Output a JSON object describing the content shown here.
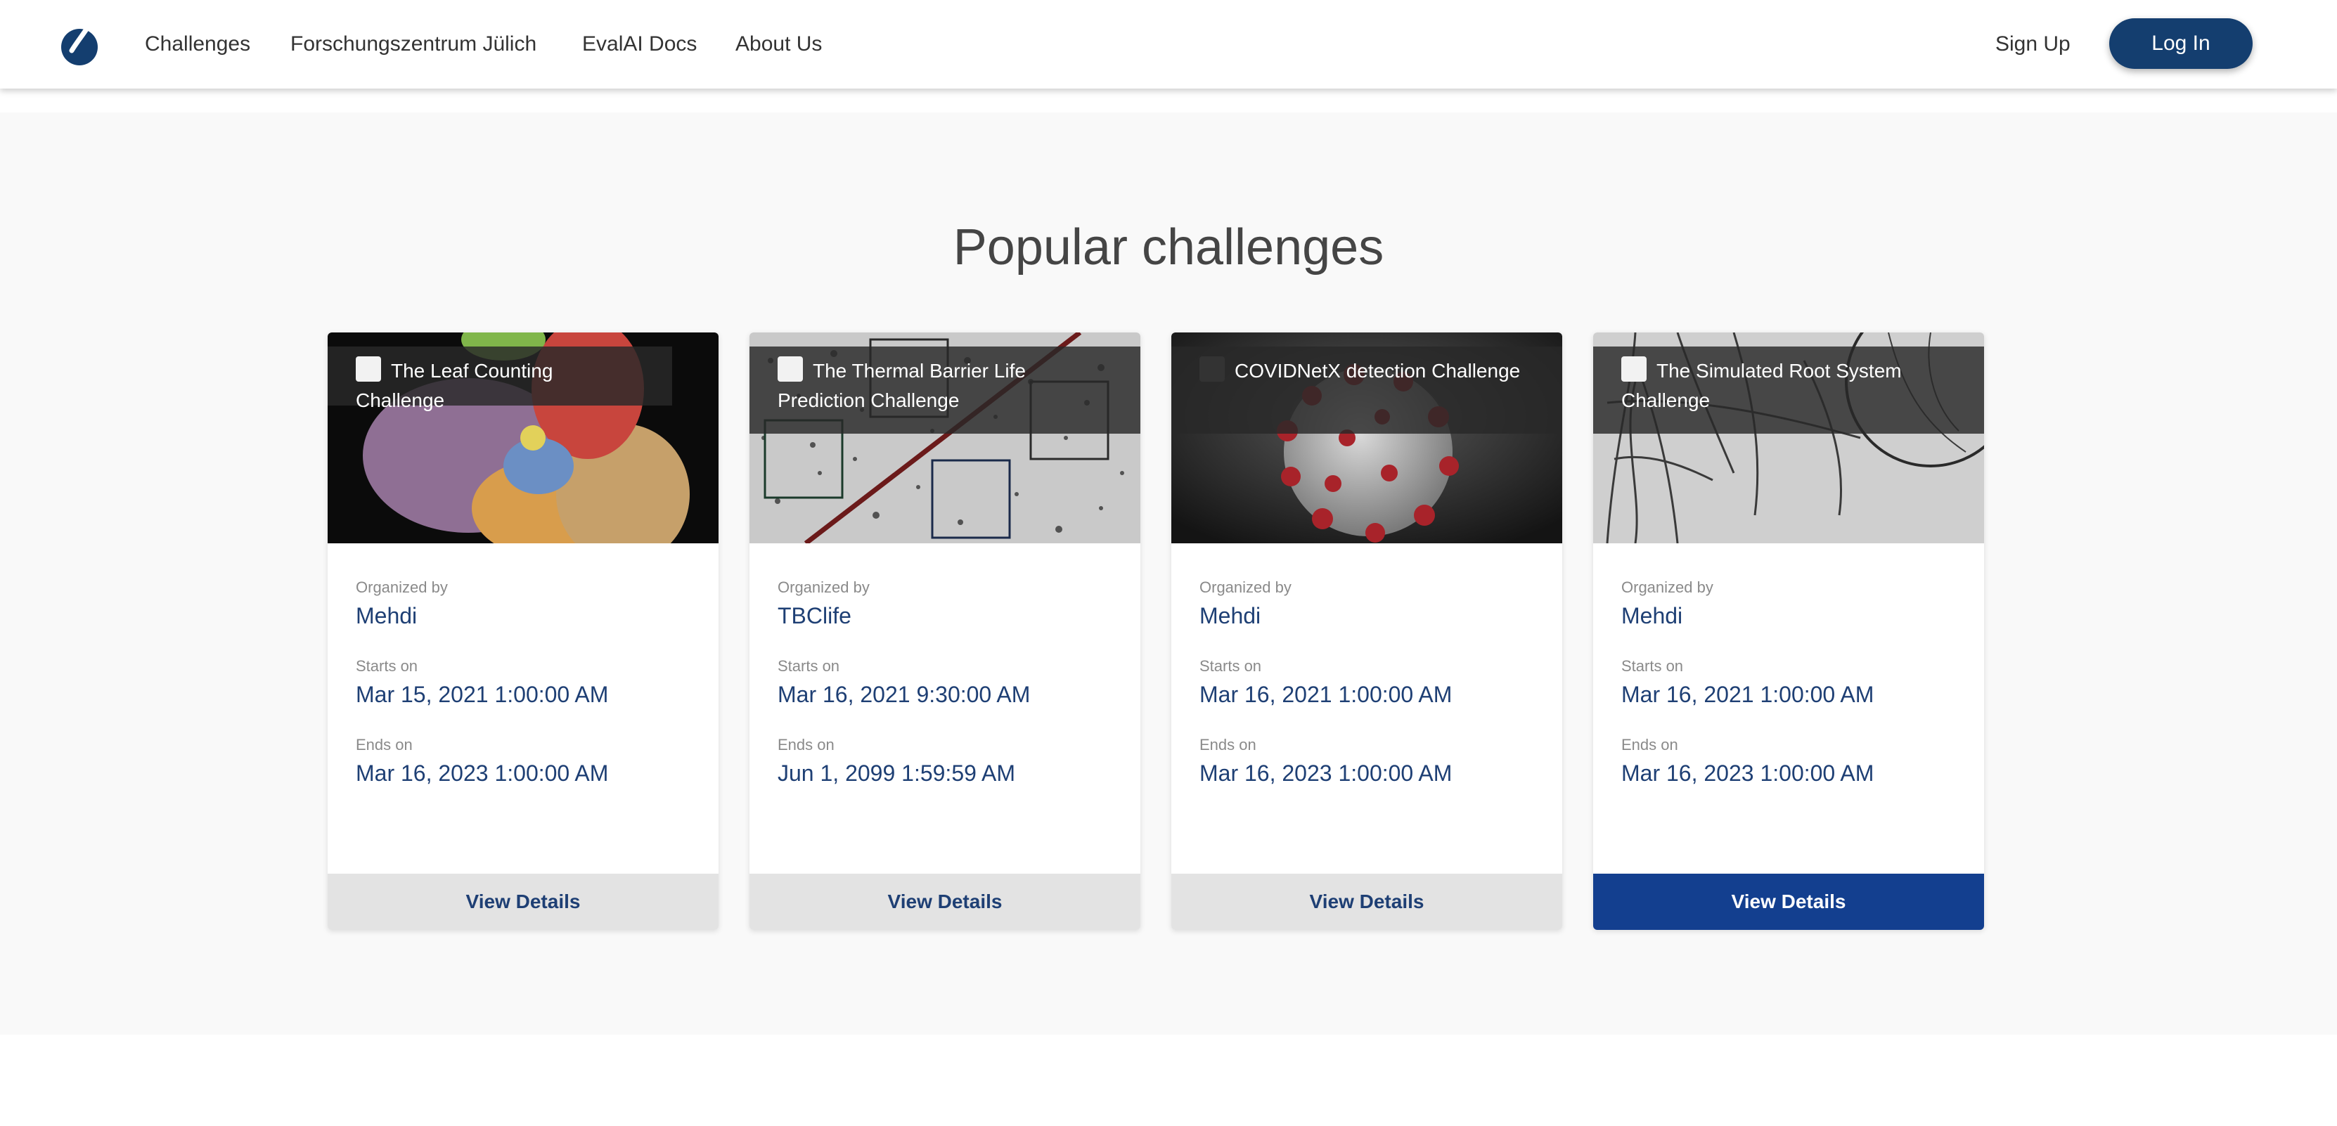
{
  "nav": {
    "links": [
      "Challenges",
      "Forschungszentrum Jülich",
      "EvalAI Docs",
      "About Us"
    ],
    "signup": "Sign Up",
    "login": "Log In"
  },
  "heading": "Popular challenges",
  "labels": {
    "organized_by": "Organized by",
    "starts_on": "Starts on",
    "ends_on": "Ends on"
  },
  "cards": [
    {
      "title": "The Leaf Counting Challenge",
      "organizer": "Mehdi",
      "start": "Mar 15, 2021 1:00:00 AM",
      "end": "Mar 16, 2023 1:00:00 AM",
      "button": "View Details"
    },
    {
      "title": "The Thermal Barrier Life Prediction Challenge",
      "organizer": "TBClife",
      "start": "Mar 16, 2021 9:30:00 AM",
      "end": "Jun 1, 2099 1:59:59 AM",
      "button": "View Details"
    },
    {
      "title": "COVIDNetX detection Challenge",
      "organizer": "Mehdi",
      "start": "Mar 16, 2021 1:00:00 AM",
      "end": "Mar 16, 2023 1:00:00 AM",
      "button": "View Details"
    },
    {
      "title": "The Simulated Root System Challenge",
      "organizer": "Mehdi",
      "start": "Mar 16, 2021 1:00:00 AM",
      "end": "Mar 16, 2023 1:00:00 AM",
      "button": "View Details"
    }
  ],
  "colors": {
    "brand": "#143e6f",
    "link_value": "#1e3f74",
    "button_active": "#133f8f",
    "button_default": "#e3e3e3"
  }
}
